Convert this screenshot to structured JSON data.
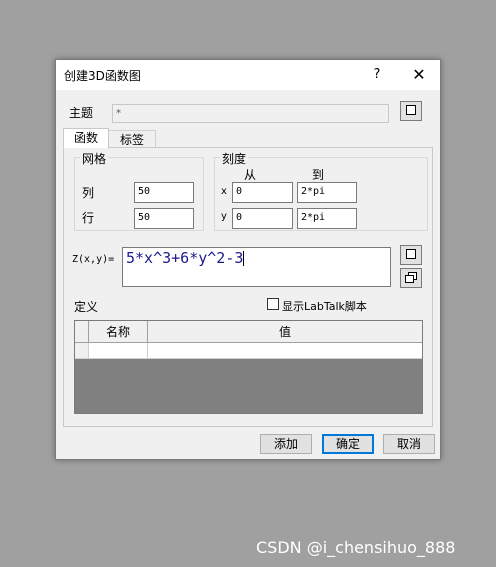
{
  "dialog": {
    "title": "创建3D函数图",
    "help": "?",
    "close": "✕"
  },
  "theme": {
    "label": "主题",
    "value": "*"
  },
  "tabs": [
    {
      "label": "函数",
      "active": true
    },
    {
      "label": "标签",
      "active": false
    }
  ],
  "grid_group": {
    "title": "网格",
    "col_label": "列",
    "col_value": "50",
    "row_label": "行",
    "row_value": "50"
  },
  "scale_group": {
    "title": "刻度",
    "from_header": "从",
    "to_header": "到",
    "x_label": "x",
    "x_from": "0",
    "x_to": "2*pi",
    "y_label": "y",
    "y_from": "0",
    "y_to": "2*pi"
  },
  "expression": {
    "label": "Z(x,y)=",
    "value": "5*x^3+6*y^2-3"
  },
  "definition": {
    "label": "定义",
    "checkbox_label": "显示LabTalk脚本",
    "checked": false,
    "columns": [
      "名称",
      "值"
    ]
  },
  "buttons": {
    "add": "添加",
    "ok": "确定",
    "cancel": "取消"
  },
  "watermark": "CSDN @i_chensihuo_888"
}
